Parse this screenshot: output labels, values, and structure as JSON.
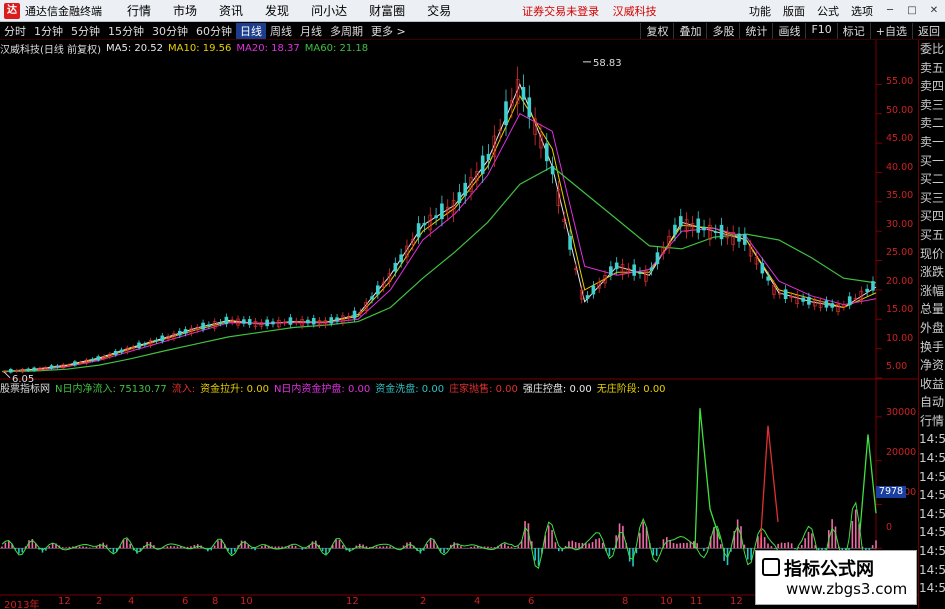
{
  "topbar": {
    "logo_glyph": "达",
    "app_title": "通达信金融终端",
    "menu": [
      "行情",
      "市场",
      "资讯",
      "发现",
      "问小达",
      "财富圈",
      "交易"
    ],
    "notice": [
      "证券交易未登录",
      "汉威科技"
    ],
    "tools": [
      "功能",
      "版面",
      "公式",
      "选项"
    ],
    "win_min": "─",
    "win_max": "□",
    "win_close": "✕"
  },
  "periodbar": {
    "periods": [
      "分时",
      "1分钟",
      "5分钟",
      "15分钟",
      "30分钟",
      "60分钟",
      "日线",
      "周线",
      "月线",
      "多周期",
      "更多 >"
    ],
    "active": "日线",
    "right": [
      "复权",
      "叠加",
      "多股",
      "统计",
      "画线",
      "F10",
      "标记",
      "+自选",
      "返回"
    ]
  },
  "main": {
    "stock": "汉威科技(日线 前复权)",
    "ma": [
      {
        "label": "MA5: 20.52",
        "color": "#e8e8e8"
      },
      {
        "label": "MA10: 19.56",
        "color": "#e8d000"
      },
      {
        "label": "MA20: 18.37",
        "color": "#e030e0"
      },
      {
        "label": "MA60: 21.18",
        "color": "#40c040"
      }
    ],
    "high_label": "58.83",
    "low_label": "6.05",
    "yticks": [
      "55.00",
      "50.00",
      "45.00",
      "40.00",
      "35.00",
      "30.00",
      "25.00",
      "20.00",
      "15.00",
      "10.00",
      "5.00"
    ]
  },
  "sub": {
    "title": "股票指标网",
    "items": [
      {
        "label": "N日内净流入: 75130.77",
        "color": "#40c040"
      },
      {
        "label": "流入: ",
        "color": "#e03030"
      },
      {
        "label": "资金拉升: 0.00",
        "color": "#e8d000"
      },
      {
        "label": "N日内资金护盘: 0.00",
        "color": "#e030e0"
      },
      {
        "label": "资金洗盘: 0.00",
        "color": "#30c0c0"
      },
      {
        "label": "庄家抛售: 0.00",
        "color": "#e03030"
      },
      {
        "label": "强庄控盘: 0.00",
        "color": "#e8e8e8"
      },
      {
        "label": "无庄阶段: 0.00",
        "color": "#e8d000"
      }
    ],
    "yticks": [
      "30000",
      "20000",
      "10000",
      "0"
    ],
    "current": "7978"
  },
  "xaxis": {
    "labels": [
      "2013年",
      "12",
      "2",
      "4",
      "6",
      "8",
      "10",
      "12",
      "2",
      "4",
      "6",
      "8",
      "10",
      "11",
      "12"
    ]
  },
  "side": [
    "委比",
    "卖五",
    "卖四",
    "卖三",
    "卖二",
    "卖一",
    "买一",
    "买二",
    "买三",
    "买四",
    "买五",
    "现价",
    "涨跌",
    "涨幅",
    "总量",
    "外盘",
    "换手",
    "净资",
    "收益",
    "自动",
    "行情",
    "14:5",
    "14:5",
    "14:5",
    "14:5",
    "14:5",
    "14:5",
    "14:5",
    "14:5",
    "14:5"
  ],
  "watermark": {
    "line1": "指标公式网",
    "line2": "www.zbgs3.com"
  },
  "chart_data": {
    "type": "line",
    "title": "汉威科技(日线 前复权)",
    "ylim": [
      5,
      60
    ],
    "series": [
      {
        "name": "MA5",
        "values": [
          6.1,
          6.5,
          7.2,
          8.4,
          10.2,
          11.8,
          13.5,
          14.8,
          14.2,
          14.6,
          14.5,
          15.8,
          22.5,
          31,
          34.5,
          42,
          55,
          41,
          18,
          24,
          22.5,
          31.5,
          30,
          28.5,
          19.5,
          18,
          17,
          20.5
        ]
      },
      {
        "name": "MA10",
        "values": [
          6.1,
          6.4,
          7.1,
          8.2,
          10,
          11.6,
          13.2,
          14.6,
          14.3,
          14.5,
          14.5,
          15.5,
          21.5,
          30,
          34,
          41,
          53,
          44,
          20,
          23,
          23,
          31,
          30.5,
          28.5,
          20,
          18.5,
          17,
          19.5
        ]
      },
      {
        "name": "MA20",
        "values": [
          6.1,
          6.3,
          6.9,
          8,
          9.6,
          11.2,
          12.8,
          14.4,
          14.3,
          14.4,
          14.4,
          15,
          20,
          28.5,
          33,
          39.5,
          50,
          47,
          24,
          22.5,
          23.5,
          30,
          30.5,
          29,
          21.5,
          19,
          17.5,
          18.5
        ]
      },
      {
        "name": "MA60",
        "values": [
          6.1,
          6.2,
          6.5,
          7.2,
          8.3,
          9.6,
          10.8,
          12,
          12.8,
          13.6,
          14,
          14.6,
          17,
          22,
          26.5,
          31.5,
          38,
          41,
          36.5,
          32,
          27.5,
          27,
          29,
          29.5,
          28.5,
          25.5,
          22,
          21.2
        ]
      }
    ],
    "high": 58.83,
    "low": 6.05,
    "sub_series": {
      "name": "N日内净流入",
      "ylim": [
        -10000,
        35000
      ],
      "last": 75130.77
    }
  }
}
